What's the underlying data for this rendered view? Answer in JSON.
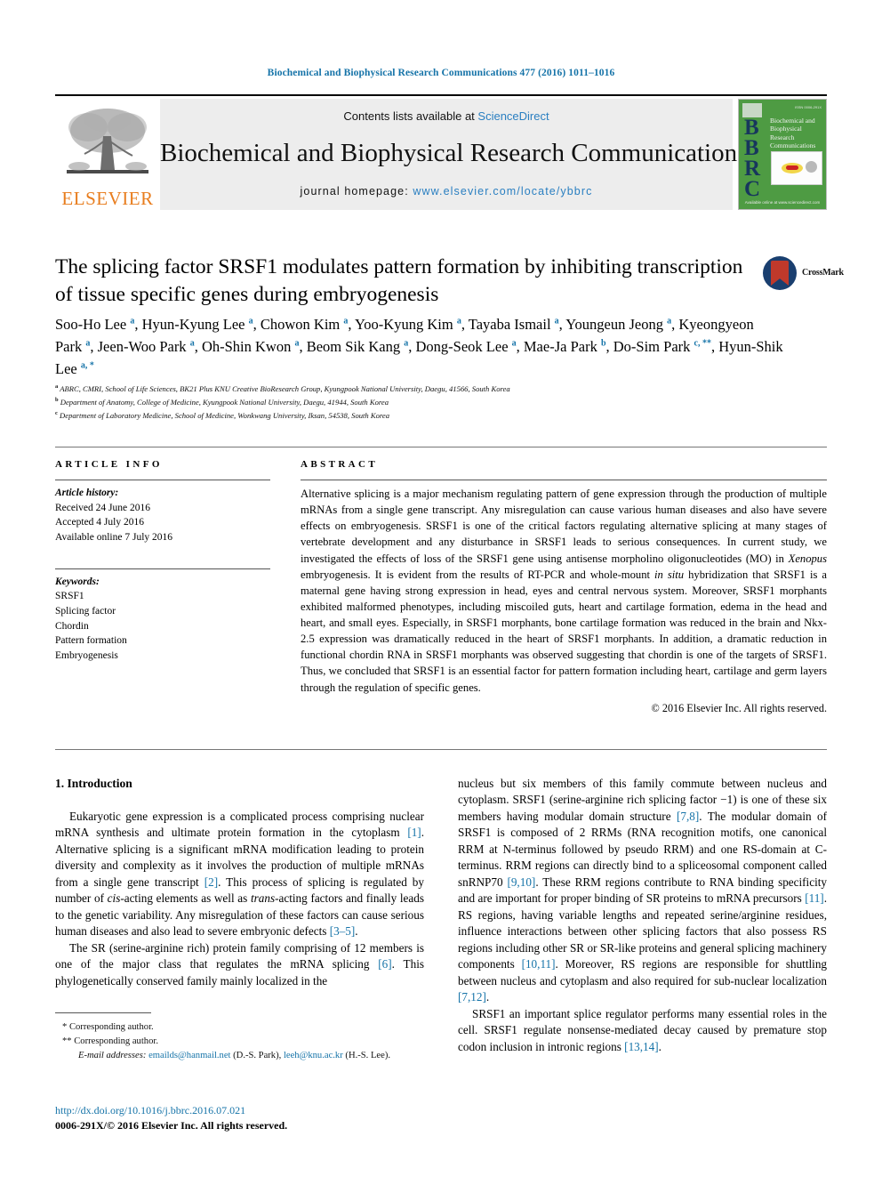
{
  "running_head": "Biochemical and Biophysical Research Communications 477 (2016) 1011–1016",
  "masthead": {
    "publisher_logo_text": "ELSEVIER",
    "contents_prefix": "Contents lists available at ",
    "contents_link": "ScienceDirect",
    "journal_title": "Biochemical and Biophysical Research Communications",
    "homepage_prefix": "journal homepage: ",
    "homepage_url": "www.elsevier.com/locate/ybbrc",
    "cover": {
      "acronym": "BBRC",
      "title_lines": "Biochemical and Biophysical Research Communications",
      "top_right_note": "ISSN 0006-291X",
      "footer_note": "Available online at www.sciencedirect.com"
    }
  },
  "title": "The splicing factor SRSF1 modulates pattern formation by inhibiting transcription of tissue specific genes during embryogenesis",
  "crossmark_label": "CrossMark",
  "authors_html": "Soo-Ho Lee <sup>a</sup>, Hyun-Kyung Lee <sup>a</sup>, Chowon Kim <sup>a</sup>, Yoo-Kyung Kim <sup>a</sup>, Tayaba Ismail <sup>a</sup>, Youngeun Jeong <sup>a</sup>, Kyeongyeon Park <sup>a</sup>, Jeen-Woo Park <sup>a</sup>, Oh-Shin Kwon <sup>a</sup>, Beom Sik Kang <sup>a</sup>, Dong-Seok Lee <sup>a</sup>, Mae-Ja Park <sup>b</sup>, Do-Sim Park <sup>c, **</sup>, Hyun-Shik Lee <sup>a, *</sup>",
  "affiliations": [
    {
      "marker": "a",
      "text": "ABRC, CMRI, School of Life Sciences, BK21 Plus KNU Creative BioResearch Group, Kyungpook National University, Daegu, 41566, South Korea"
    },
    {
      "marker": "b",
      "text": "Department of Anatomy, College of Medicine, Kyungpook National University, Daegu, 41944, South Korea"
    },
    {
      "marker": "c",
      "text": "Department of Laboratory Medicine, School of Medicine, Wonkwang University, Iksan, 54538, South Korea"
    }
  ],
  "article_info": {
    "heading": "ARTICLE INFO",
    "history_label": "Article history:",
    "history": [
      "Received 24 June 2016",
      "Accepted 4 July 2016",
      "Available online 7 July 2016"
    ],
    "keywords_label": "Keywords:",
    "keywords": [
      "SRSF1",
      "Splicing factor",
      "Chordin",
      "Pattern formation",
      "Embryogenesis"
    ]
  },
  "abstract": {
    "heading": "ABSTRACT",
    "body_html": "Alternative splicing is a major mechanism regulating pattern of gene expression through the production of multiple mRNAs from a single gene transcript. Any misregulation can cause various human diseases and also have severe effects on embryogenesis. SRSF1 is one of the critical factors regulating alternative splicing at many stages of vertebrate development and any disturbance in SRSF1 leads to serious consequences. In current study, we investigated the effects of loss of the SRSF1 gene using antisense morpholino oligonucleotides (MO) in <span class=\"ital\">Xenopus</span> embryogenesis. It is evident from the results of RT-PCR and whole-mount <span class=\"ital\">in situ</span> hybridization that SRSF1 is a maternal gene having strong expression in head, eyes and central nervous system. Moreover, SRSF1 morphants exhibited malformed phenotypes, including miscoiled guts, heart and cartilage formation, edema in the head and heart, and small eyes. Especially, in SRSF1 morphants, bone cartilage formation was reduced in the brain and Nkx-2.5 expression was dramatically reduced in the heart of SRSF1 morphants. In addition, a dramatic reduction in functional chordin RNA in SRSF1 morphants was observed suggesting that chordin is one of the targets of SRSF1. Thus, we concluded that SRSF1 is an essential factor for pattern formation including heart, cartilage and germ layers through the regulation of specific genes.",
    "copyright": "© 2016 Elsevier Inc. All rights reserved."
  },
  "introduction": {
    "heading": "1. Introduction",
    "left_paragraphs_html": [
      "Eukaryotic gene expression is a complicated process comprising nuclear mRNA synthesis and ultimate protein formation in the cytoplasm <span class=\"ref\">[1]</span>. Alternative splicing is a significant mRNA modification leading to protein diversity and complexity as it involves the production of multiple mRNAs from a single gene transcript <span class=\"ref\">[2]</span>. This process of splicing is regulated by number of <span class=\"ital\">cis</span>-acting elements as well as <span class=\"ital\">trans</span>-acting factors and finally leads to the genetic variability. Any misregulation of these factors can cause serious human diseases and also lead to severe embryonic defects <span class=\"ref\">[3–5]</span>.",
      "The SR (serine-arginine rich) protein family comprising of 12 members is one of the major class that regulates the mRNA splicing <span class=\"ref\">[6]</span>. This phylogenetically conserved family mainly localized in the"
    ],
    "right_paragraphs_html": [
      "nucleus but six members of this family commute between nucleus and cytoplasm. SRSF1 (serine-arginine rich splicing factor −1) is one of these six members having modular domain structure <span class=\"ref\">[7,8]</span>. The modular domain of SRSF1 is composed of 2 RRMs (RNA recognition motifs, one canonical RRM at N-terminus followed by pseudo RRM) and one RS-domain at C-terminus. RRM regions can directly bind to a spliceosomal component called snRNP70 <span class=\"ref\">[9,10]</span>. These RRM regions contribute to RNA binding specificity and are important for proper binding of SR proteins to mRNA precursors <span class=\"ref\">[11]</span>. RS regions, having variable lengths and repeated serine/arginine residues, influence interactions between other splicing factors that also possess RS regions including other SR or SR-like proteins and general splicing machinery components <span class=\"ref\">[10,11]</span>. Moreover, RS regions are responsible for shuttling between nucleus and cytoplasm and also required for sub-nuclear localization <span class=\"ref\">[7,12]</span>.",
      "SRSF1 an important splice regulator performs many essential roles in the cell. SRSF1 regulate nonsense-mediated decay caused by premature stop codon inclusion in intronic regions <span class=\"ref\">[13,14]</span>."
    ]
  },
  "footnotes": {
    "corresponding_single": "* Corresponding author.",
    "corresponding_double": "** Corresponding author.",
    "email_label": "E-mail addresses:",
    "email_1": "emailds@hanmail.net",
    "email_1_owner": "(D.-S. Park),",
    "email_2": "leeh@knu.ac.kr",
    "email_2_owner": "(H.-S. Lee)."
  },
  "publication": {
    "doi": "http://dx.doi.org/10.1016/j.bbrc.2016.07.021",
    "issn_line": "0006-291X/© 2016 Elsevier Inc. All rights reserved."
  }
}
